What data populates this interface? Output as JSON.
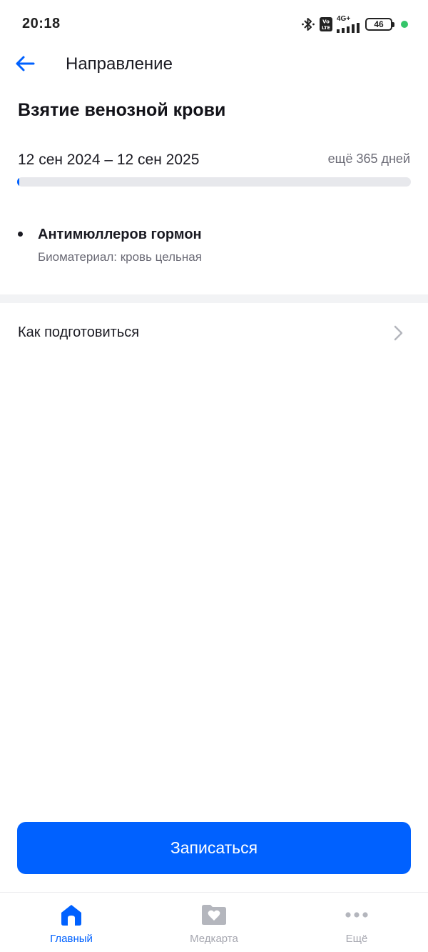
{
  "status_bar": {
    "time": "20:18",
    "network": "4G+",
    "volte": "Vo LTE",
    "battery": "46"
  },
  "header": {
    "title": "Направление",
    "back_icon": "arrow-left-icon"
  },
  "referral": {
    "title": "Взятие венозной крови",
    "date_range": "12 сен 2024 – 12 сен 2025",
    "days_left": "ещё 365 дней",
    "progress": 0.005
  },
  "tests": [
    {
      "name": "Антимюллеров гормон",
      "biomaterial": "Биоматериал: кровь цельная"
    }
  ],
  "preparation": {
    "label": "Как подготовиться"
  },
  "actions": {
    "book_label": "Записаться"
  },
  "bottom_nav": {
    "items": [
      {
        "label": "Главный",
        "icon": "home-icon",
        "active": true
      },
      {
        "label": "Медкарта",
        "icon": "medcard-folder-icon",
        "active": false
      },
      {
        "label": "Ещё",
        "icon": "more-dots-icon",
        "active": false
      }
    ]
  },
  "colors": {
    "accent": "#0061ff",
    "inactive": "#a6a7b0",
    "track": "#e7e8ec"
  }
}
